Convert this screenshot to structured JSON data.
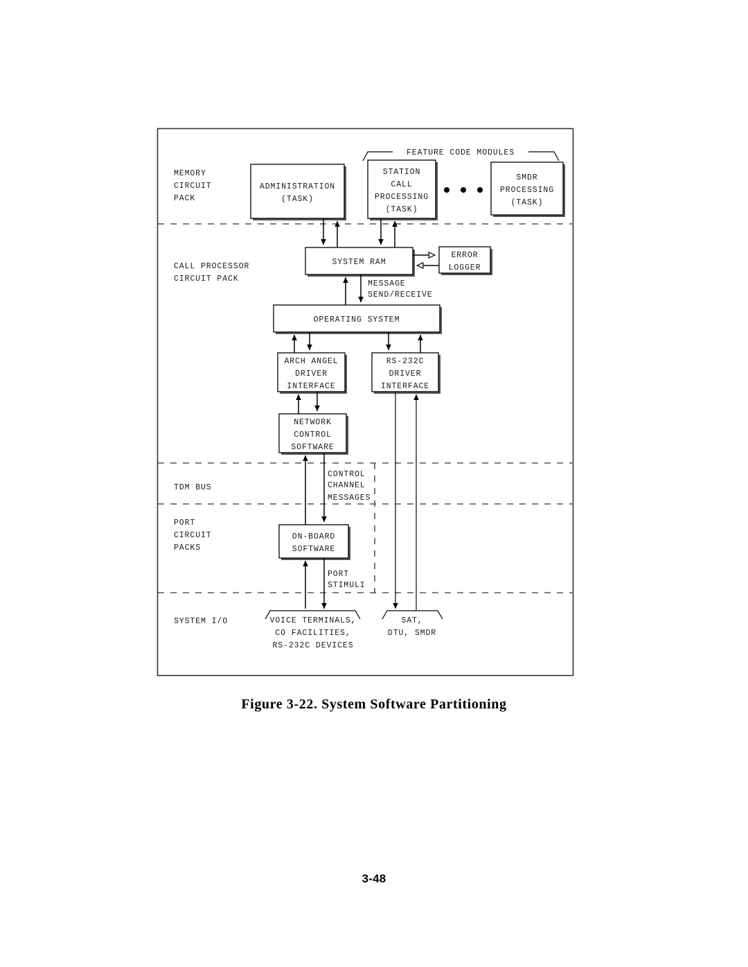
{
  "figure": {
    "caption": "Figure 3-22.  System  Software  Partitioning",
    "page_number": "3-48"
  },
  "chart_data": {
    "type": "diagram",
    "title": "System Software Partitioning",
    "bands": [
      {
        "id": "memory_circuit_pack",
        "label_lines": [
          "MEMORY",
          "CIRCUIT",
          "PACK"
        ]
      },
      {
        "id": "call_processor_circuit_pack",
        "label_lines": [
          "CALL  PROCESSOR",
          "CIRCUIT  PACK"
        ]
      },
      {
        "id": "tdm_bus",
        "label_lines": [
          "TDM BUS"
        ]
      },
      {
        "id": "port_circuit_packs",
        "label_lines": [
          "PORT",
          "CIRCUIT",
          "PACKS"
        ]
      },
      {
        "id": "system_io",
        "label_lines": [
          "SYSTEM  I/O"
        ]
      }
    ],
    "group_label": "FEATURE  CODE  MODULES",
    "boxes": [
      {
        "id": "administration",
        "lines": [
          "ADMINISTRATION",
          "(TASK)"
        ]
      },
      {
        "id": "station_call_processing",
        "lines": [
          "STATION",
          "CALL",
          "PROCESSING",
          "(TASK)"
        ]
      },
      {
        "id": "smdr_processing",
        "lines": [
          "SMDR",
          "PROCESSING",
          "(TASK)"
        ]
      },
      {
        "id": "system_ram",
        "lines": [
          "SYSTEM  RAM"
        ]
      },
      {
        "id": "error_logger",
        "lines": [
          "ERROR",
          "LOGGER"
        ]
      },
      {
        "id": "operating_system",
        "lines": [
          "OPERATING  SYSTEM"
        ]
      },
      {
        "id": "arch_angel_driver_interface",
        "lines": [
          "ARCH  ANGEL",
          "DRIVER",
          "INTERFACE"
        ]
      },
      {
        "id": "rs232c_driver_interface",
        "lines": [
          "RS-232C",
          "DRIVER",
          "INTERFACE"
        ]
      },
      {
        "id": "network_control_software",
        "lines": [
          "NETWORK",
          "CONTROL",
          "SOFTWARE"
        ]
      },
      {
        "id": "on_board_software",
        "lines": [
          "ON-BOARD",
          "SOFTWARE"
        ]
      }
    ],
    "edge_labels": [
      {
        "id": "message_send_receive",
        "lines": [
          "MESSAGE",
          "SEND/RECEIVE"
        ]
      },
      {
        "id": "control_channel_messages",
        "lines": [
          "CONTROL",
          "CHANNEL",
          "MESSAGES"
        ]
      },
      {
        "id": "port_stimuli",
        "lines": [
          "PORT",
          "STIMULI"
        ]
      }
    ],
    "io_groups": [
      {
        "id": "io_left",
        "lines": [
          "VOICE  TERMINALS,",
          "CO FACILITIES,",
          "RS-232C  DEVICES"
        ]
      },
      {
        "id": "io_right",
        "lines": [
          "SAT,",
          "DTU,  SMDR"
        ]
      }
    ],
    "ellipsis_dots": 3
  },
  "diagram": {
    "band_labels": {
      "memory_1": "MEMORY",
      "memory_2": "CIRCUIT",
      "memory_3": "PACK",
      "callproc_1": "CALL  PROCESSOR",
      "callproc_2": "CIRCUIT  PACK",
      "tdm": "TDM BUS",
      "port_1": "PORT",
      "port_2": "CIRCUIT",
      "port_3": "PACKS",
      "sysio": "SYSTEM  I/O"
    },
    "group_label": "FEATURE  CODE  MODULES",
    "administration": {
      "l1": "ADMINISTRATION",
      "l2": "(TASK)"
    },
    "station_call": {
      "l1": "STATION",
      "l2": "CALL",
      "l3": "PROCESSING",
      "l4": "(TASK)"
    },
    "smdr": {
      "l1": "SMDR",
      "l2": "PROCESSING",
      "l3": "(TASK)"
    },
    "system_ram": {
      "l1": "SYSTEM  RAM"
    },
    "error_logger": {
      "l1": "ERROR",
      "l2": "LOGGER"
    },
    "operating_system": {
      "l1": "OPERATING  SYSTEM"
    },
    "arch_angel": {
      "l1": "ARCH  ANGEL",
      "l2": "DRIVER",
      "l3": "INTERFACE"
    },
    "rs232c": {
      "l1": "RS-232C",
      "l2": "DRIVER",
      "l3": "INTERFACE"
    },
    "network_control": {
      "l1": "NETWORK",
      "l2": "CONTROL",
      "l3": "SOFTWARE"
    },
    "on_board": {
      "l1": "ON-BOARD",
      "l2": "SOFTWARE"
    },
    "message_label": {
      "l1": "MESSAGE",
      "l2": "SEND/RECEIVE"
    },
    "control_channel": {
      "l1": "CONTROL",
      "l2": "CHANNEL",
      "l3": "MESSAGES"
    },
    "port_stimuli": {
      "l1": "PORT",
      "l2": "STIMULI"
    },
    "io_left": {
      "l1": "VOICE  TERMINALS,",
      "l2": "CO FACILITIES,",
      "l3": "RS-232C  DEVICES"
    },
    "io_right": {
      "l1": "SAT,",
      "l2": "DTU,  SMDR"
    }
  }
}
